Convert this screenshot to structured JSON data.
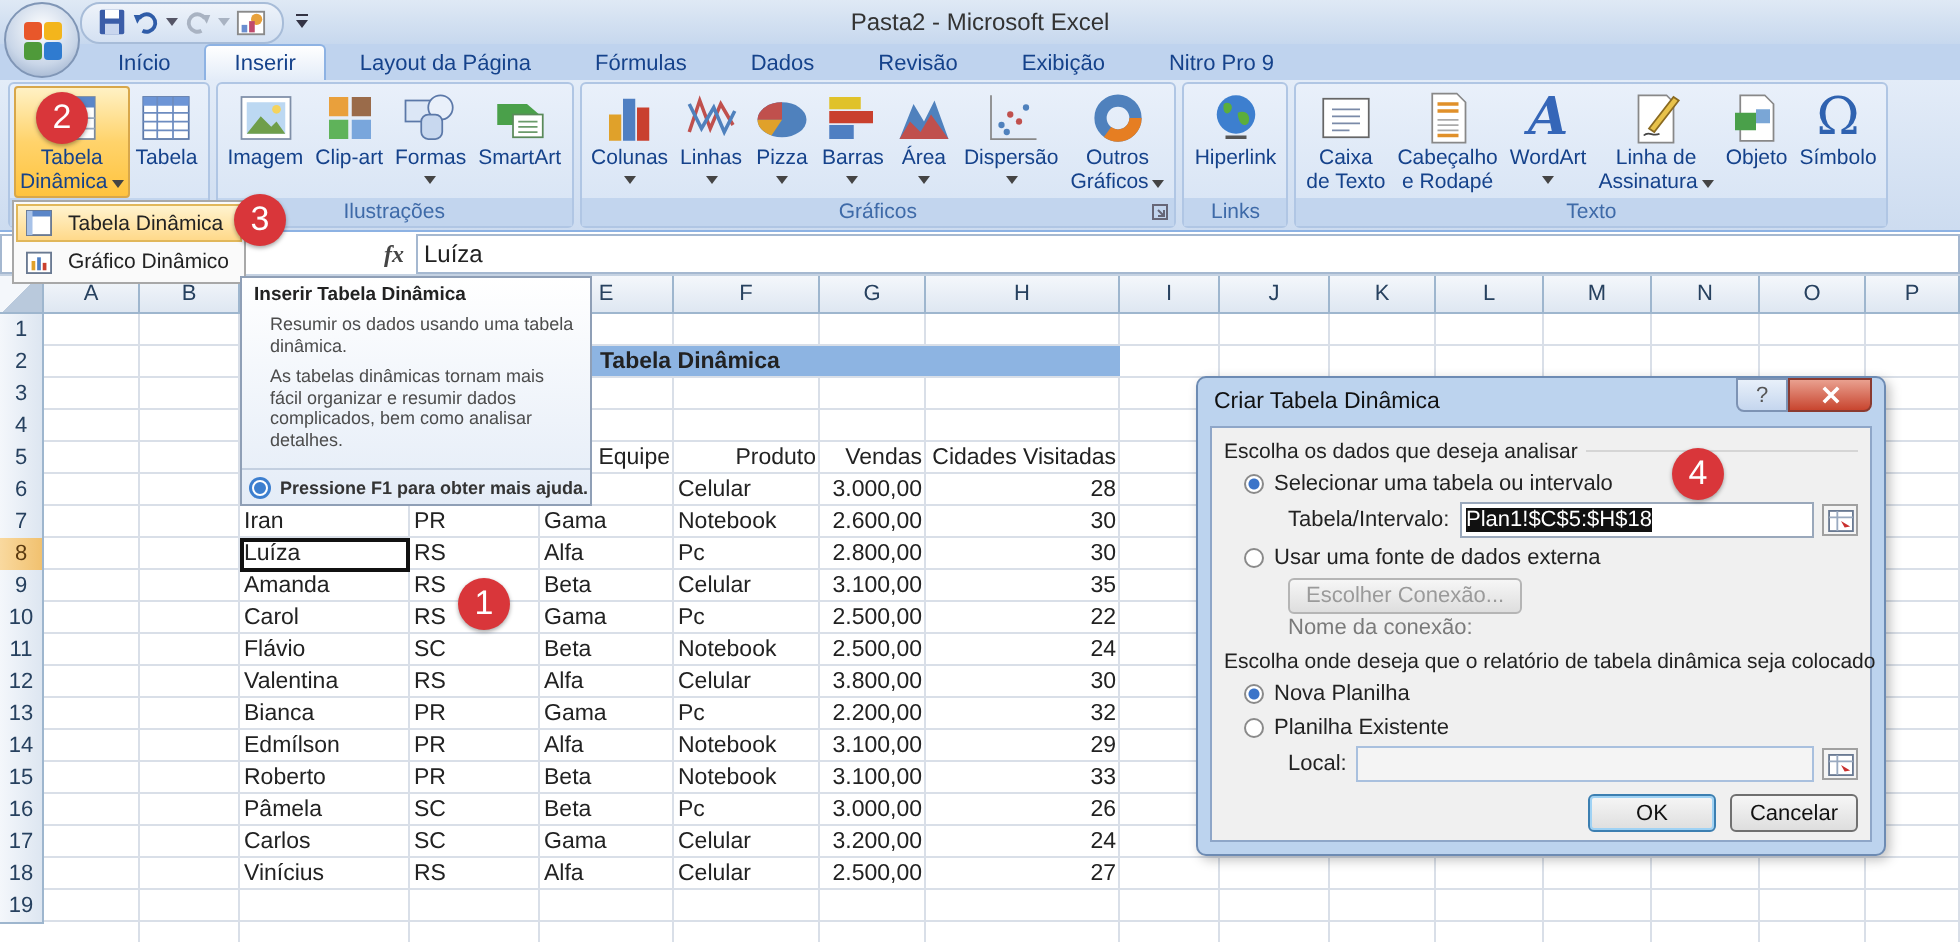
{
  "window": {
    "title": "Pasta2 - Microsoft Excel"
  },
  "tabs": [
    {
      "label": "Início",
      "selected": false
    },
    {
      "label": "Inserir",
      "selected": true
    },
    {
      "label": "Layout da Página",
      "selected": false
    },
    {
      "label": "Fórmulas",
      "selected": false
    },
    {
      "label": "Dados",
      "selected": false
    },
    {
      "label": "Revisão",
      "selected": false
    },
    {
      "label": "Exibição",
      "selected": false
    },
    {
      "label": "Nitro Pro 9",
      "selected": false
    }
  ],
  "ribbon": {
    "groups": [
      {
        "buttons": [
          {
            "lines": [
              "Tabela",
              "Dinâmica"
            ],
            "dropdown": true,
            "active": true
          },
          {
            "lines": [
              "Tabela"
            ],
            "dropdown": false,
            "active": false
          }
        ]
      },
      {
        "label": "Ilustrações",
        "buttons": [
          {
            "lines": [
              "Imagem"
            ],
            "dropdown": false,
            "active": false
          },
          {
            "lines": [
              "Clip-art"
            ],
            "dropdown": false,
            "active": false
          },
          {
            "lines": [
              "Formas"
            ],
            "dropdown": true,
            "active": false
          },
          {
            "lines": [
              "SmartArt"
            ],
            "dropdown": false,
            "active": false
          }
        ]
      },
      {
        "label": "Gráficos",
        "launcher": true,
        "buttons": [
          {
            "lines": [
              "Colunas"
            ],
            "dropdown": true,
            "active": false
          },
          {
            "lines": [
              "Linhas"
            ],
            "dropdown": true,
            "active": false
          },
          {
            "lines": [
              "Pizza"
            ],
            "dropdown": true,
            "active": false
          },
          {
            "lines": [
              "Barras"
            ],
            "dropdown": true,
            "active": false
          },
          {
            "lines": [
              "Área"
            ],
            "dropdown": true,
            "active": false
          },
          {
            "lines": [
              "Dispersão"
            ],
            "dropdown": true,
            "active": false
          },
          {
            "lines": [
              "Outros",
              "Gráficos"
            ],
            "dropdown": true,
            "active": false
          }
        ]
      },
      {
        "label": "Links",
        "buttons": [
          {
            "lines": [
              "Hiperlink"
            ],
            "dropdown": false,
            "active": false
          }
        ]
      },
      {
        "label": "Texto",
        "buttons": [
          {
            "lines": [
              "Caixa",
              "de Texto"
            ],
            "dropdown": false,
            "active": false
          },
          {
            "lines": [
              "Cabeçalho",
              "e Rodapé"
            ],
            "dropdown": false,
            "active": false
          },
          {
            "glyph": "A",
            "lines": [
              "WordArt"
            ],
            "dropdown": true,
            "active": false
          },
          {
            "lines": [
              "Linha de",
              "Assinatura"
            ],
            "dropdown": true,
            "active": false
          },
          {
            "lines": [
              "Objeto"
            ],
            "dropdown": false,
            "active": false
          },
          {
            "glyph": "Ω",
            "lines": [
              "Símbolo"
            ],
            "dropdown": false,
            "active": false
          }
        ]
      }
    ]
  },
  "dropdown_menu": {
    "items": [
      {
        "label": "Tabela Dinâmica",
        "selected": true
      },
      {
        "label": "Gráfico Dinâmico",
        "selected": false
      }
    ]
  },
  "formula_bar": {
    "fx_label": "fx",
    "value": "Luíza"
  },
  "sheet": {
    "columns": [
      {
        "label": "A"
      },
      {
        "label": "B"
      },
      {},
      {},
      {
        "label": "E"
      },
      {
        "label": "F"
      },
      {
        "label": "G"
      },
      {
        "label": "H"
      },
      {
        "label": "I"
      },
      {
        "label": "J"
      },
      {
        "label": "K"
      },
      {
        "label": "L"
      },
      {
        "label": "M"
      },
      {
        "label": "N"
      },
      {
        "label": "O"
      },
      {
        "label": "P"
      }
    ],
    "rows": [
      {
        "n": "1",
        "selected": false,
        "cells": []
      },
      {
        "n": "2",
        "selected": false,
        "kind": "title",
        "title": "Tabela Dinâmica",
        "cells": []
      },
      {
        "n": "3",
        "selected": false,
        "cells": []
      },
      {
        "n": "4",
        "selected": false,
        "cells": []
      },
      {
        "n": "5",
        "selected": false,
        "kind": "header",
        "cells": [
          {},
          {},
          {},
          {},
          {
            "text": "Equipe"
          },
          {
            "text": "Produto"
          },
          {
            "text": "Vendas"
          },
          {
            "text": "Cidades Visitadas"
          }
        ]
      },
      {
        "n": "6",
        "selected": false,
        "cells": [
          {},
          {},
          {},
          {},
          {},
          {
            "text": "Celular"
          },
          {
            "text": "3.000,00",
            "kind": "number"
          },
          {
            "text": "28",
            "kind": "number"
          }
        ]
      },
      {
        "n": "7",
        "selected": false,
        "cells": [
          {},
          {},
          {
            "text": "Iran"
          },
          {
            "text": "PR"
          },
          {
            "text": "Gama"
          },
          {
            "text": "Notebook"
          },
          {
            "text": "2.600,00",
            "kind": "number"
          },
          {
            "text": "30",
            "kind": "number"
          }
        ]
      },
      {
        "n": "8",
        "selected": true,
        "cells": [
          {},
          {},
          {
            "text": "Luíza",
            "active": true
          },
          {
            "text": "RS"
          },
          {
            "text": "Alfa"
          },
          {
            "text": "Pc"
          },
          {
            "text": "2.800,00",
            "kind": "number"
          },
          {
            "text": "30",
            "kind": "number"
          }
        ]
      },
      {
        "n": "9",
        "selected": false,
        "cells": [
          {},
          {},
          {
            "text": "Amanda"
          },
          {
            "text": "RS"
          },
          {
            "text": "Beta"
          },
          {
            "text": "Celular"
          },
          {
            "text": "3.100,00",
            "kind": "number"
          },
          {
            "text": "35",
            "kind": "number"
          }
        ]
      },
      {
        "n": "10",
        "selected": false,
        "cells": [
          {},
          {},
          {
            "text": "Carol"
          },
          {
            "text": "RS"
          },
          {
            "text": "Gama"
          },
          {
            "text": "Pc"
          },
          {
            "text": "2.500,00",
            "kind": "number"
          },
          {
            "text": "22",
            "kind": "number"
          }
        ]
      },
      {
        "n": "11",
        "selected": false,
        "cells": [
          {},
          {},
          {
            "text": "Flávio"
          },
          {
            "text": "SC"
          },
          {
            "text": "Beta"
          },
          {
            "text": "Notebook"
          },
          {
            "text": "2.500,00",
            "kind": "number"
          },
          {
            "text": "24",
            "kind": "number"
          }
        ]
      },
      {
        "n": "12",
        "selected": false,
        "cells": [
          {},
          {},
          {
            "text": "Valentina"
          },
          {
            "text": "RS"
          },
          {
            "text": "Alfa"
          },
          {
            "text": "Celular"
          },
          {
            "text": "3.800,00",
            "kind": "number"
          },
          {
            "text": "30",
            "kind": "number"
          }
        ]
      },
      {
        "n": "13",
        "selected": false,
        "cells": [
          {},
          {},
          {
            "text": "Bianca"
          },
          {
            "text": "PR"
          },
          {
            "text": "Gama"
          },
          {
            "text": "Pc"
          },
          {
            "text": "2.200,00",
            "kind": "number"
          },
          {
            "text": "32",
            "kind": "number"
          }
        ]
      },
      {
        "n": "14",
        "selected": false,
        "cells": [
          {},
          {},
          {
            "text": "Edmílson"
          },
          {
            "text": "PR"
          },
          {
            "text": "Alfa"
          },
          {
            "text": "Notebook"
          },
          {
            "text": "3.100,00",
            "kind": "number"
          },
          {
            "text": "29",
            "kind": "number"
          }
        ]
      },
      {
        "n": "15",
        "selected": false,
        "cells": [
          {},
          {},
          {
            "text": "Roberto"
          },
          {
            "text": "PR"
          },
          {
            "text": "Beta"
          },
          {
            "text": "Notebook"
          },
          {
            "text": "3.100,00",
            "kind": "number"
          },
          {
            "text": "33",
            "kind": "number"
          }
        ]
      },
      {
        "n": "16",
        "selected": false,
        "cells": [
          {},
          {},
          {
            "text": "Pâmela"
          },
          {
            "text": "SC"
          },
          {
            "text": "Beta"
          },
          {
            "text": "Pc"
          },
          {
            "text": "3.000,00",
            "kind": "number"
          },
          {
            "text": "26",
            "kind": "number"
          }
        ]
      },
      {
        "n": "17",
        "selected": false,
        "cells": [
          {},
          {},
          {
            "text": "Carlos"
          },
          {
            "text": "SC"
          },
          {
            "text": "Gama"
          },
          {
            "text": "Celular"
          },
          {
            "text": "3.200,00",
            "kind": "number"
          },
          {
            "text": "24",
            "kind": "number"
          }
        ]
      },
      {
        "n": "18",
        "selected": false,
        "cells": [
          {},
          {},
          {
            "text": "Vinícius"
          },
          {
            "text": "RS"
          },
          {
            "text": "Alfa"
          },
          {
            "text": "Celular"
          },
          {
            "text": "2.500,00",
            "kind": "number"
          },
          {
            "text": "27",
            "kind": "number"
          }
        ]
      },
      {
        "n": "19",
        "selected": false,
        "cells": []
      }
    ]
  },
  "tooltip": {
    "title": "Inserir Tabela Dinâmica",
    "paragraphs": [
      "Resumir os dados usando uma tabela dinâmica.",
      "As tabelas dinâmicas tornam mais fácil organizar e resumir dados complicados, bem como analisar detalhes."
    ],
    "footer": "Pressione F1 para obter mais ajuda."
  },
  "dialog": {
    "title": "Criar Tabela Dinâmica",
    "help_label": "?",
    "sections": [
      {
        "heading": "Escolha os dados que deseja analisar",
        "options": [
          {
            "label": "Selecionar uma tabela ou intervalo",
            "selected": true,
            "field": {
              "label": "Tabela/Intervalo:",
              "value": "Plan1!$C$5:$H$18",
              "value_selected": true,
              "disabled": false
            }
          },
          {
            "label": "Usar uma fonte de dados externa",
            "selected": false,
            "button": {
              "label": "Escolher Conexão...",
              "disabled": true
            },
            "note": "Nome da conexão:"
          }
        ]
      },
      {
        "heading": "Escolha onde deseja que o relatório de tabela dinâmica seja colocado",
        "options": [
          {
            "label": "Nova Planilha",
            "selected": true
          },
          {
            "label": "Planilha Existente",
            "selected": false,
            "field": {
              "label": "Local:",
              "disabled": true
            }
          }
        ]
      }
    ],
    "buttons": [
      {
        "label": "OK",
        "default": true
      },
      {
        "label": "Cancelar",
        "default": false
      }
    ]
  },
  "markers": [
    {
      "label": "1"
    },
    {
      "label": "2"
    },
    {
      "label": "3"
    },
    {
      "label": "4"
    }
  ]
}
